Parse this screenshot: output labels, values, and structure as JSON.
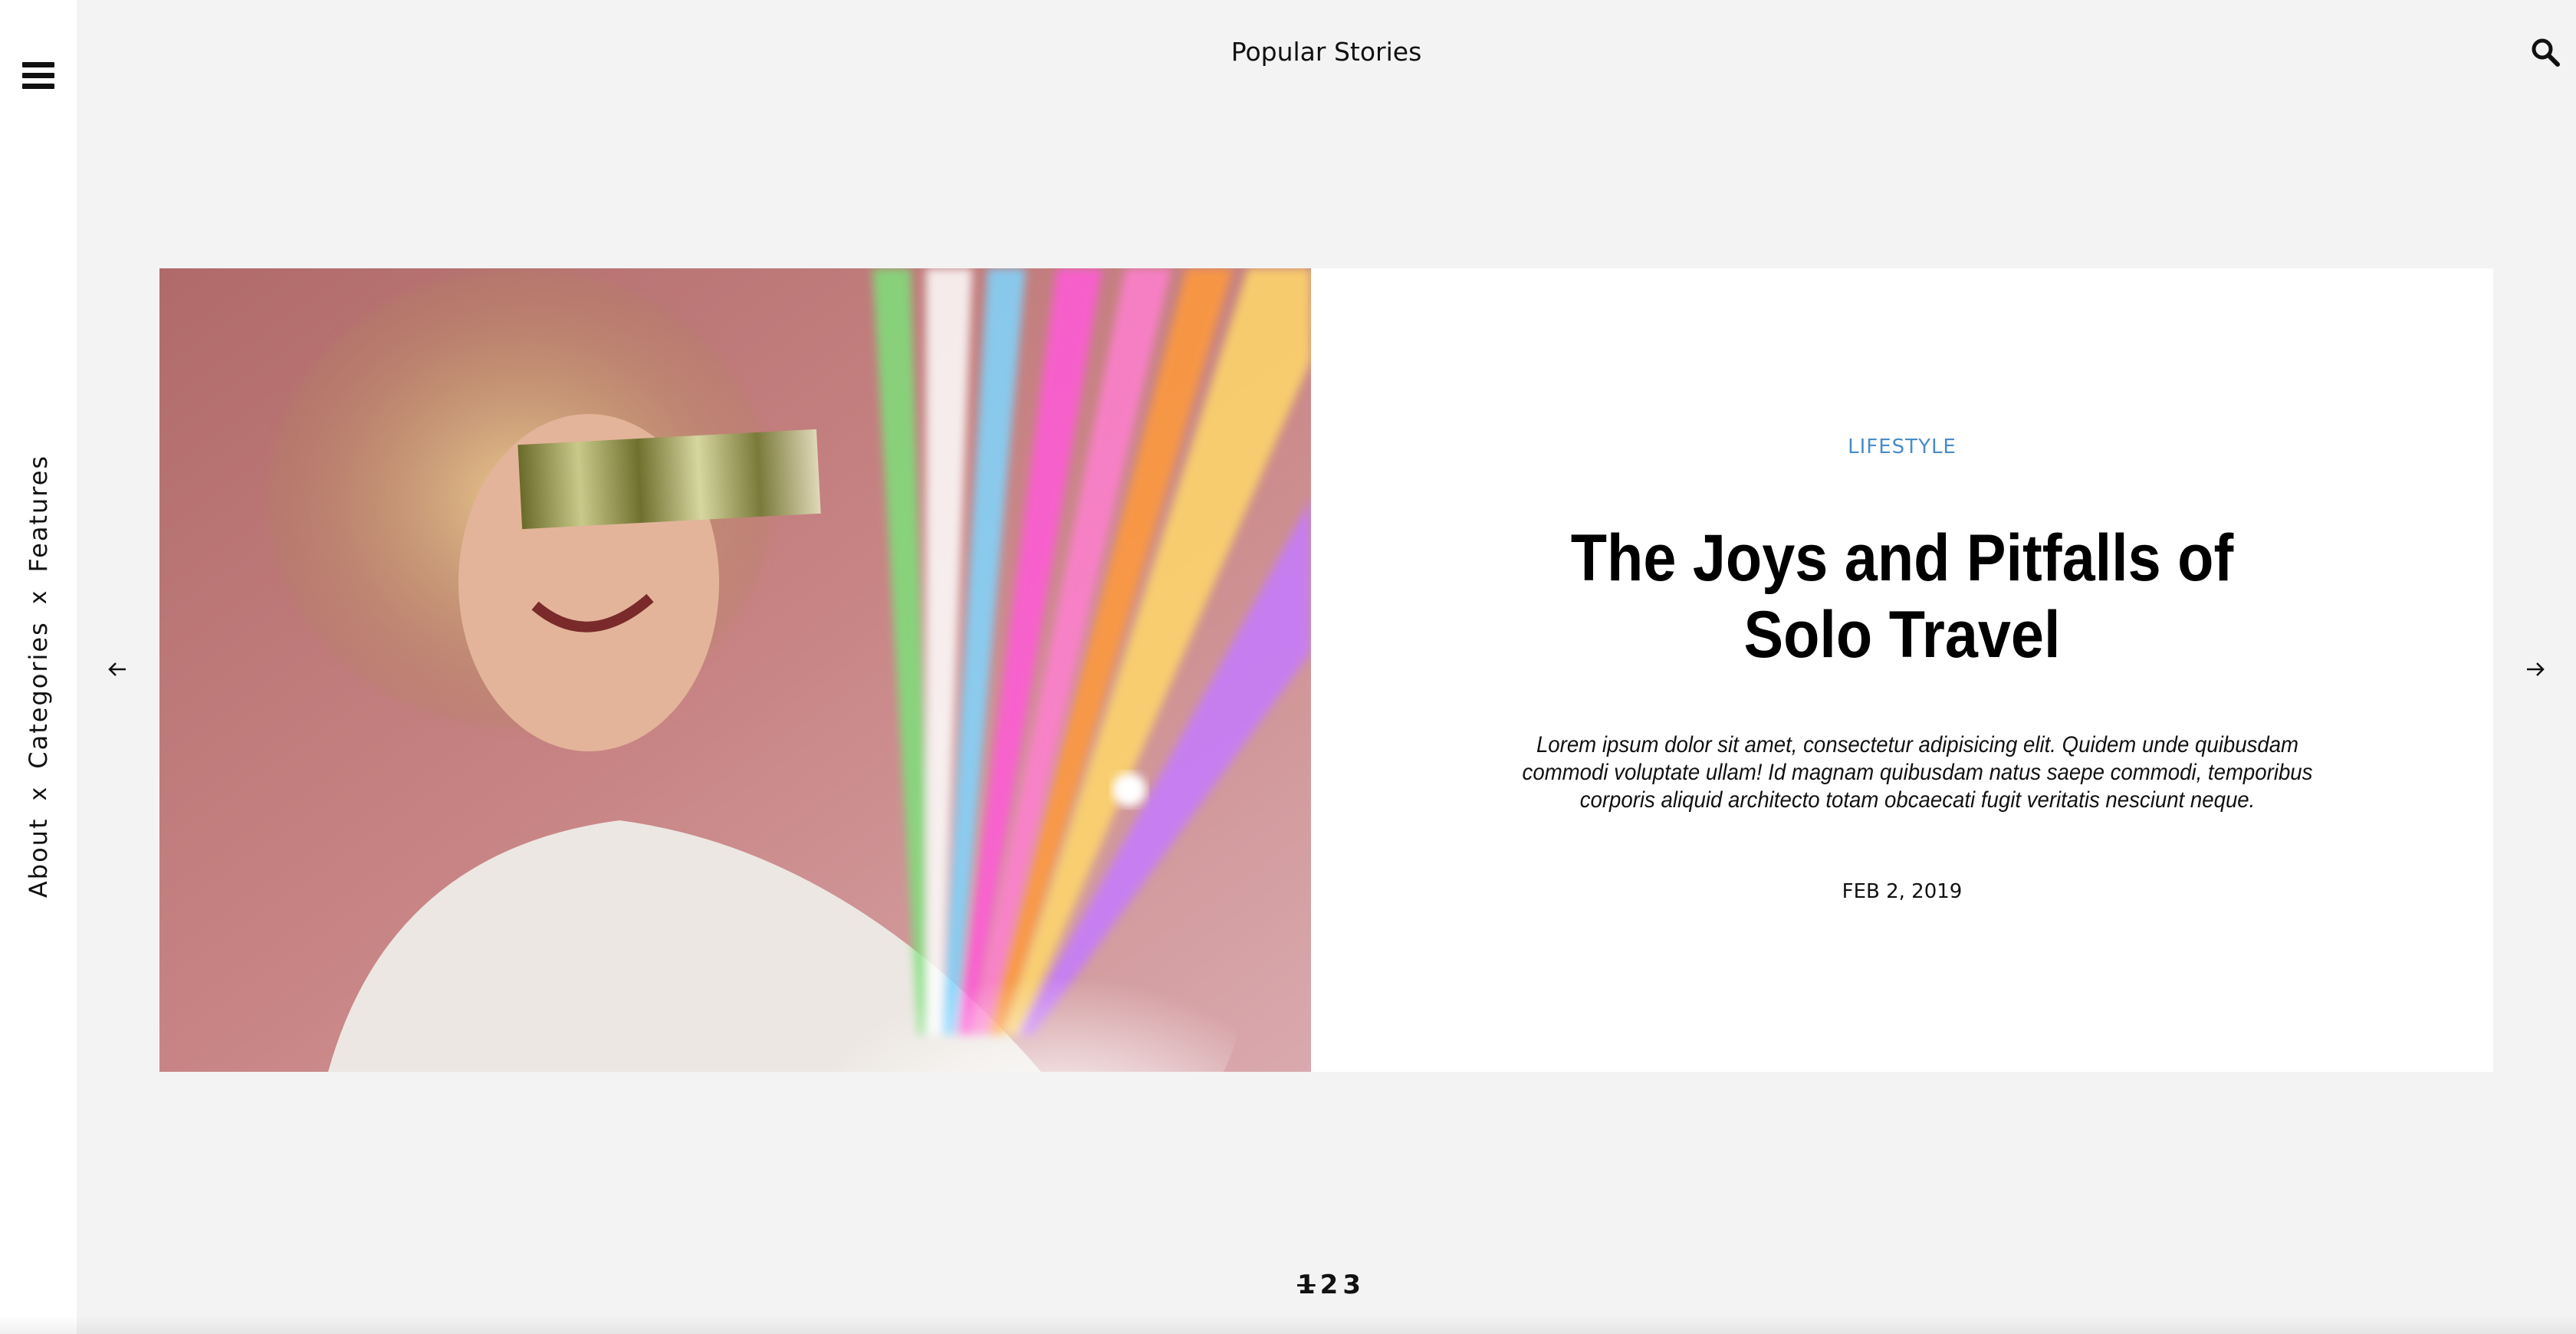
{
  "header": {
    "title": "Popular Stories",
    "menu_icon": "hamburger-menu-icon",
    "search_icon": "search-icon"
  },
  "sidebar": {
    "nav": [
      {
        "label": "About"
      },
      {
        "label": "Categories"
      },
      {
        "label": "Features"
      }
    ],
    "separator": "x"
  },
  "story": {
    "category": "LIFESTYLE",
    "title": "The Joys and Pitfalls of Solo Travel",
    "excerpt": "Lorem ipsum dolor sit amet, consectetur adipisicing elit. Quidem unde quibusdam commodi voluptate ullam! Id magnam quibusdam natus saepe commodi, temporibus corporis aliquid architecto totam obcaecati fugit veritatis nesciunt neque.",
    "date": "FEB 2, 2019",
    "category_color": "#4a8bc8"
  },
  "carousel": {
    "prev_icon": "arrow-left-icon",
    "next_icon": "arrow-right-icon"
  },
  "pagination": {
    "pages": [
      "1",
      "2",
      "3"
    ],
    "current": "1"
  }
}
